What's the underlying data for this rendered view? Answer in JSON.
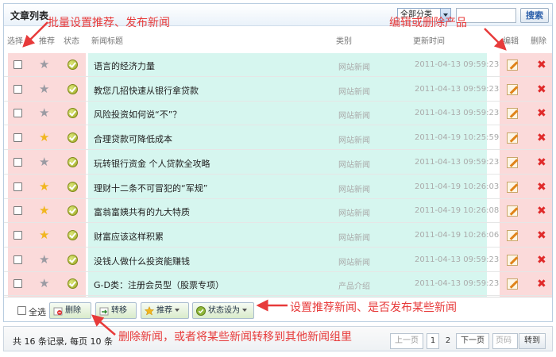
{
  "header": {
    "title": "文章列表",
    "category_selected": "全部分类",
    "search_label": "搜索"
  },
  "columns": {
    "select": "选择",
    "recommend": "推荐",
    "status": "状态",
    "title": "新闻标题",
    "category": "类别",
    "updated": "更新时间",
    "edit": "编辑",
    "delete": "删除"
  },
  "rows": [
    {
      "title": "语言的经济力量",
      "category": "网站新闻",
      "time": "2011-04-13 09:59:23",
      "starred": false
    },
    {
      "title": "教您几招快速从银行拿贷款",
      "category": "网站新闻",
      "time": "2011-04-13 09:59:23",
      "starred": false
    },
    {
      "title": "风险投资如何说“不”？",
      "category": "网站新闻",
      "time": "2011-04-13 09:59:23",
      "starred": false
    },
    {
      "title": "合理贷款可降低成本",
      "category": "网站新闻",
      "time": "2011-04-19 10:25:59",
      "starred": true
    },
    {
      "title": "玩转银行资金  个人贷款全攻略",
      "category": "网站新闻",
      "time": "2011-04-13 09:59:23",
      "starred": false
    },
    {
      "title": "理财十二条不可冒犯的“军规”",
      "category": "网站新闻",
      "time": "2011-04-19 10:26:03",
      "starred": true
    },
    {
      "title": "富翁富姨共有的九大特质",
      "category": "网站新闻",
      "time": "2011-04-19 10:26:08",
      "starred": true
    },
    {
      "title": "财富应该这样积累",
      "category": "网站新闻",
      "time": "2011-04-19 10:26:06",
      "starred": true
    },
    {
      "title": "没钱人做什么投资能赚钱",
      "category": "网站新闻",
      "time": "2011-04-13 09:59:23",
      "starred": false
    },
    {
      "title": "G-D类：注册会员型（股票专项）",
      "category": "产品介绍",
      "time": "2011-04-13 09:59:23",
      "starred": false
    }
  ],
  "toolbar": {
    "select_all": "全选",
    "delete": "删除",
    "move": "转移",
    "recommend": "推荐",
    "status": "状态设为"
  },
  "pager": {
    "summary": "共 16 条记录, 每页  10 条",
    "prev": "上一页",
    "page1": "1",
    "page2": "2",
    "next": "下一页",
    "page_placeholder": "页码",
    "goto": "转到"
  },
  "annotations": {
    "batch": "批量设置推荐、发布新闻",
    "edit_delete": "编辑或删除产品",
    "set_status": "设置推荐新闻、是否发布某些新闻",
    "move_delete": "删除新闻，或者将某些新闻转移到其他新闻组里"
  },
  "colors": {
    "annotation": "#e73a3a",
    "row_pink": "#fbdada",
    "row_cyan": "#d6f6ef"
  }
}
